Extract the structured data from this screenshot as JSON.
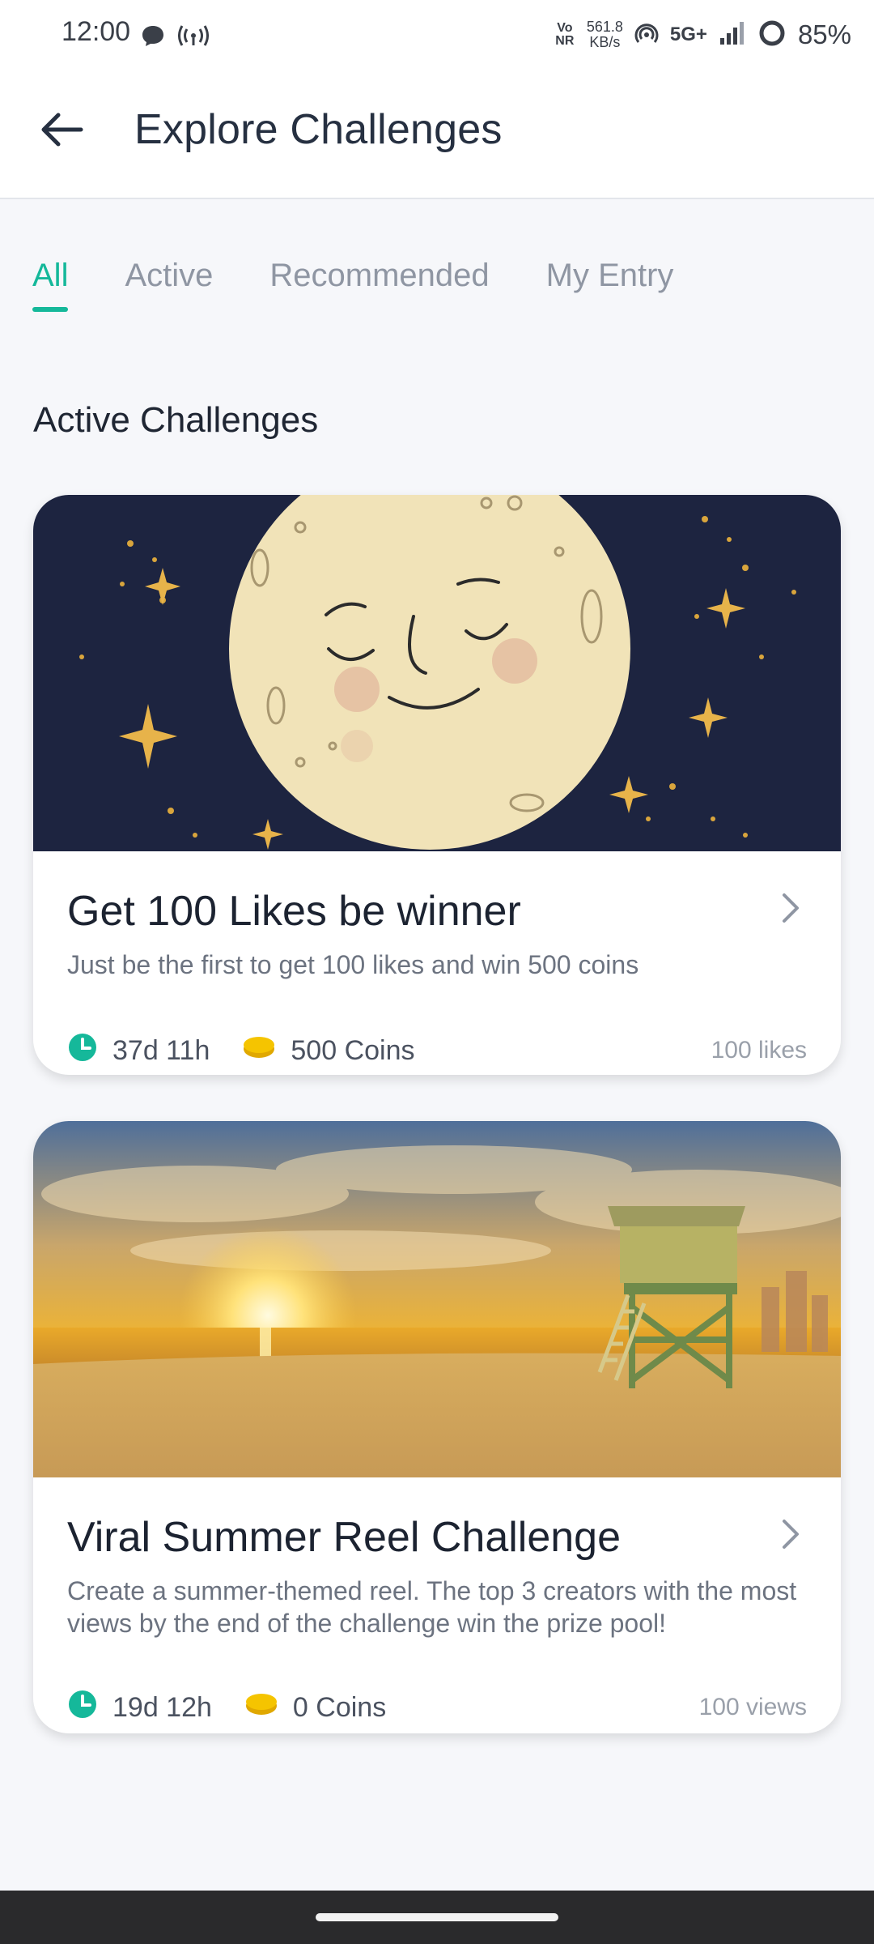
{
  "status_bar": {
    "time": "12:00",
    "vonr": "Vo NR",
    "speed_value": "561.8",
    "speed_unit": "KB/s",
    "network": "5G+",
    "battery": "85%"
  },
  "header": {
    "title": "Explore Challenges"
  },
  "tabs": [
    {
      "label": "All",
      "active": true
    },
    {
      "label": "Active",
      "active": false
    },
    {
      "label": "Recommended",
      "active": false
    },
    {
      "label": "My Entry",
      "active": false
    }
  ],
  "section": {
    "title": "Active Challenges"
  },
  "challenges": [
    {
      "title": "Get 100 Likes be winner",
      "description": "Just be the first to get 100 likes and win 500 coins",
      "time_left": "37d 11h",
      "reward": "500 Coins",
      "goal": "100 likes",
      "image": "moon-illustration"
    },
    {
      "title": "Viral Summer Reel Challenge",
      "description": "Create a summer-themed reel. The top 3 creators with the most views by the end of the challenge win the prize pool!",
      "time_left": "19d 12h",
      "reward": "0 Coins",
      "goal": "100 views",
      "image": "beach-sunset-photo"
    }
  ],
  "colors": {
    "accent": "#15b89a",
    "coin": "#f5c400",
    "title_text": "#263041",
    "muted_text": "#8f96a3"
  },
  "icons": {
    "back": "back-arrow-icon",
    "clock": "clock-icon",
    "coin": "coin-icon",
    "chevron": "chevron-right-icon"
  }
}
